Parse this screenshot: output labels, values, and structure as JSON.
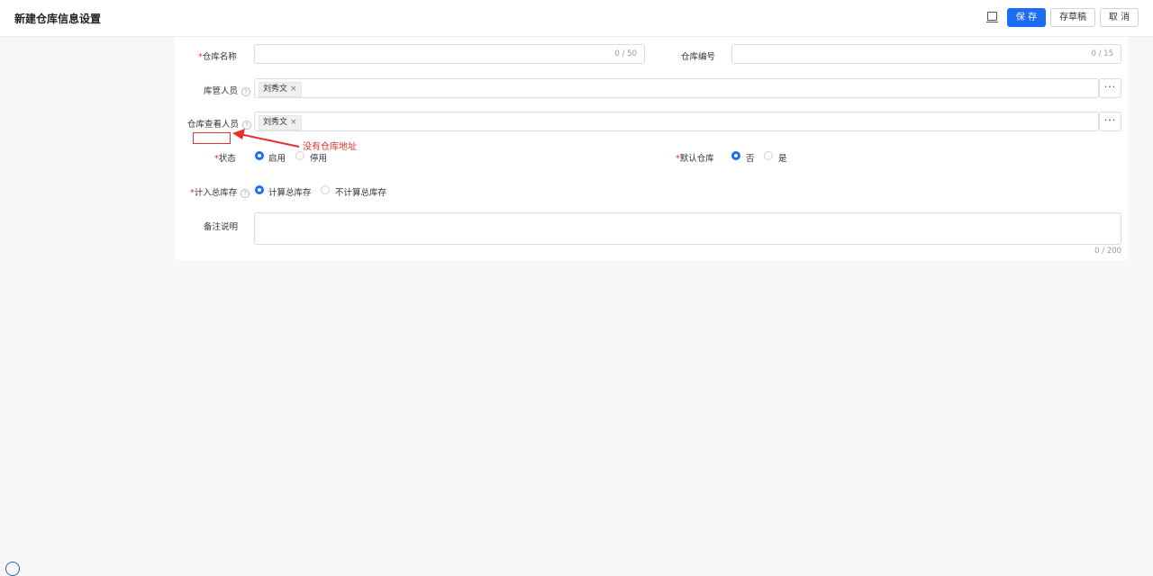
{
  "header": {
    "title": "新建仓库信息设置",
    "icon": "laptop-icon",
    "save_label": "保 存",
    "draft_label": "存草稿",
    "cancel_label": "取 消"
  },
  "form": {
    "warehouse_name": {
      "required_mark": "*",
      "label": "仓库名称",
      "value": "",
      "counter": "0 / 50"
    },
    "warehouse_code": {
      "label": "仓库编号",
      "value": "",
      "counter": "0 / 15"
    },
    "managers": {
      "label": "库管人员",
      "help": "?",
      "tags": [
        "刘秀文"
      ],
      "tag_close": "×",
      "more": "···"
    },
    "viewers": {
      "label": "仓库查看人员",
      "help": "?",
      "tags": [
        "刘秀文"
      ],
      "tag_close": "×",
      "more": "···"
    },
    "status": {
      "required_mark": "*",
      "label": "状态",
      "options": [
        "启用",
        "停用"
      ],
      "selected": "启用"
    },
    "default_warehouse": {
      "required_mark": "*",
      "label": "默认仓库",
      "options": [
        "否",
        "是"
      ],
      "selected": "否"
    },
    "count_total": {
      "required_mark": "*",
      "label": "计入总库存",
      "help": "?",
      "options": [
        "计算总库存",
        "不计算总库存"
      ],
      "selected": "计算总库存"
    },
    "remarks": {
      "label": "备注说明",
      "value": "",
      "counter": "0 / 200"
    }
  },
  "annotation": {
    "text": "没有仓库地址",
    "color": "#e5322d"
  },
  "colors": {
    "primary": "#1b6ef3",
    "required": "#e5322d"
  }
}
